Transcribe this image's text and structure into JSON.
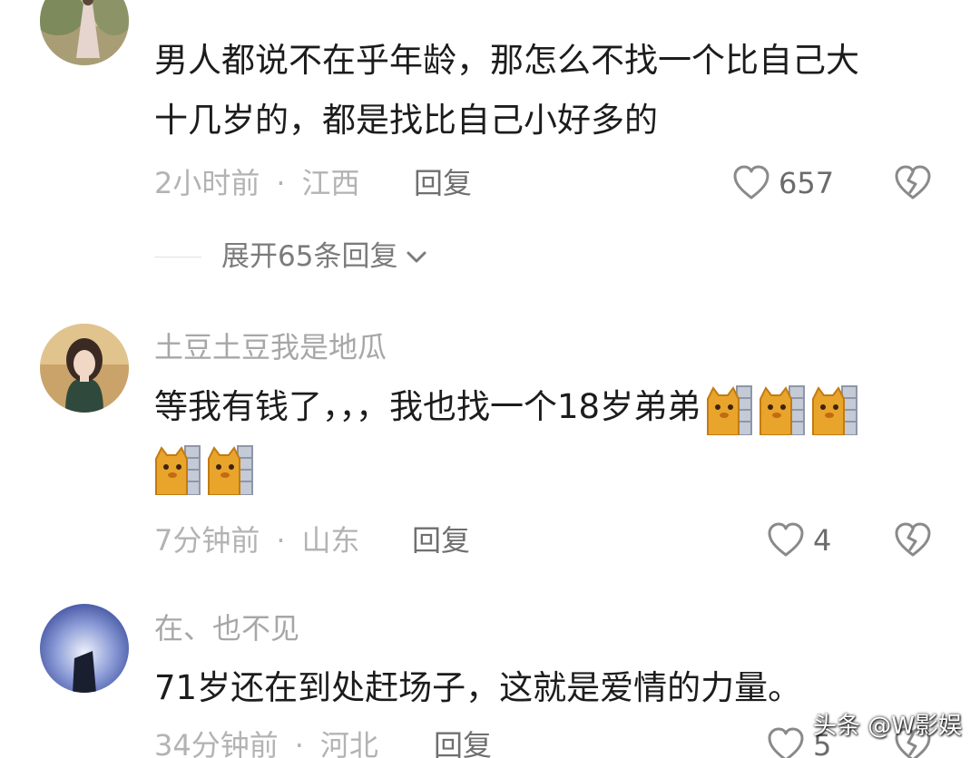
{
  "comments": [
    {
      "username": "",
      "text_lines": [
        "男人都说不在乎年龄，那怎么不找一个比自己大",
        "十几岁的，都是找比自己小好多的"
      ],
      "time": "2小时前",
      "location": "江西",
      "reply_label": "回复",
      "likes": "657",
      "expand_label": "展开65条回复"
    },
    {
      "username": "土豆土豆我是地瓜",
      "text_lines": [
        "等我有钱了，，，我也找一个18岁弟弟",
        ""
      ],
      "emoji": "peeking-cat-emoji",
      "emoji_count_line1": 3,
      "emoji_count_line2": 2,
      "time": "7分钟前",
      "location": "山东",
      "reply_label": "回复",
      "likes": "4"
    },
    {
      "username": "在、也不见",
      "text_lines": [
        "71岁还在到处赶场子，这就是爱情的力量。"
      ],
      "time": "34分钟前",
      "location": "河北",
      "reply_label": "回复",
      "likes": "5"
    }
  ],
  "meta_separator": "·",
  "watermark": "头条 @W影娱",
  "colors": {
    "text": "#1c1c1c",
    "meta": "#b3b3b3",
    "username": "#a7a7a7",
    "reply": "#6f6f6f",
    "icon": "#8a8a8a"
  }
}
